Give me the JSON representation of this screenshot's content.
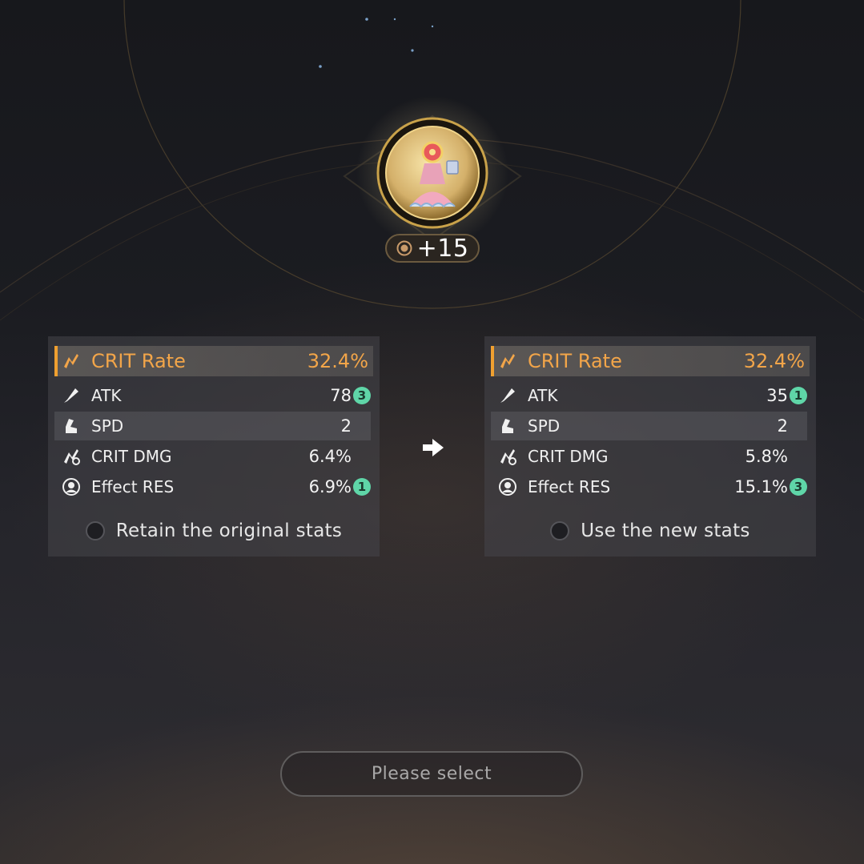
{
  "relic": {
    "icon": "relic-dress-icon",
    "level_badge": "+15"
  },
  "panels": {
    "original": {
      "main_stat": {
        "icon": "crit-rate-icon",
        "name": "CRIT Rate",
        "value": "32.4%"
      },
      "sub_stats": [
        {
          "icon": "atk-icon",
          "name": "ATK",
          "value": "78",
          "rolls": "3"
        },
        {
          "icon": "spd-icon",
          "name": "SPD",
          "value": "2",
          "rolls": ""
        },
        {
          "icon": "crit-dmg-icon",
          "name": "CRIT DMG",
          "value": "6.4%",
          "rolls": ""
        },
        {
          "icon": "effect-res-icon",
          "name": "Effect RES",
          "value": "6.9%",
          "rolls": "1"
        }
      ],
      "choice_label": "Retain the original stats"
    },
    "new": {
      "main_stat": {
        "icon": "crit-rate-icon",
        "name": "CRIT Rate",
        "value": "32.4%"
      },
      "sub_stats": [
        {
          "icon": "atk-icon",
          "name": "ATK",
          "value": "35",
          "rolls": "1"
        },
        {
          "icon": "spd-icon",
          "name": "SPD",
          "value": "2",
          "rolls": ""
        },
        {
          "icon": "crit-dmg-icon",
          "name": "CRIT DMG",
          "value": "5.8%",
          "rolls": ""
        },
        {
          "icon": "effect-res-icon",
          "name": "Effect RES",
          "value": "15.1%",
          "rolls": "3"
        }
      ],
      "choice_label": "Use the new stats"
    }
  },
  "arrow_icon": "arrow-right-icon",
  "select_button": {
    "label": "Please select"
  },
  "colors": {
    "main_stat": "#f2a549",
    "accent_bar": "#f0a030",
    "roll_badge": "#5fd6a8",
    "gold": "#d9b25c"
  }
}
